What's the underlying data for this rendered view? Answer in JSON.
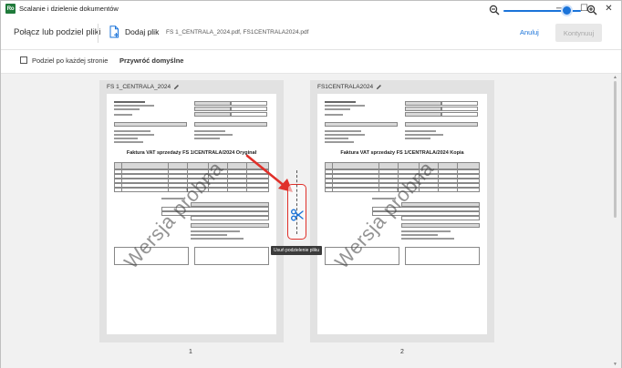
{
  "window": {
    "title": "Scalanie i dzielenie dokumentów",
    "logo_text": "Ro",
    "controls": {
      "minimize": "─",
      "maximize": "☐",
      "close": "✕"
    }
  },
  "toolbar": {
    "title": "Połącz lub podziel pliki",
    "add_file_label": "Dodaj plik",
    "file_names": "FS 1_CENTRALA_2024.pdf, FS1CENTRALA2024.pdf",
    "cancel_label": "Anuluj",
    "continue_label": "Kontynuuj"
  },
  "options": {
    "split_each_page_label": "Podziel po każdej stronie",
    "split_each_page_checked": false,
    "restore_default_label": "Przywróć domyślne",
    "zoom_level_fraction": 0.82
  },
  "pages": [
    {
      "file_label": "FS 1_CENTRALA_2024",
      "number": "1",
      "doc_title": "Faktura VAT sprzedaży FS 1/CENTRALA/2024 Oryginał",
      "watermark": "Wersja próbna"
    },
    {
      "file_label": "FS1CENTRALA2024",
      "number": "2",
      "doc_title": "Faktura VAT sprzedaży FS 1/CENTRALA/2024 Kopia",
      "watermark": "Wersja próbna"
    }
  ],
  "split": {
    "tooltip": "Usuń podzielenie pliku"
  },
  "colors": {
    "accent": "#1a73d9",
    "highlight": "#e0302a",
    "canvas": "#f1f1f1",
    "card": "#e2e2e2",
    "logo": "#1f7a3a"
  }
}
